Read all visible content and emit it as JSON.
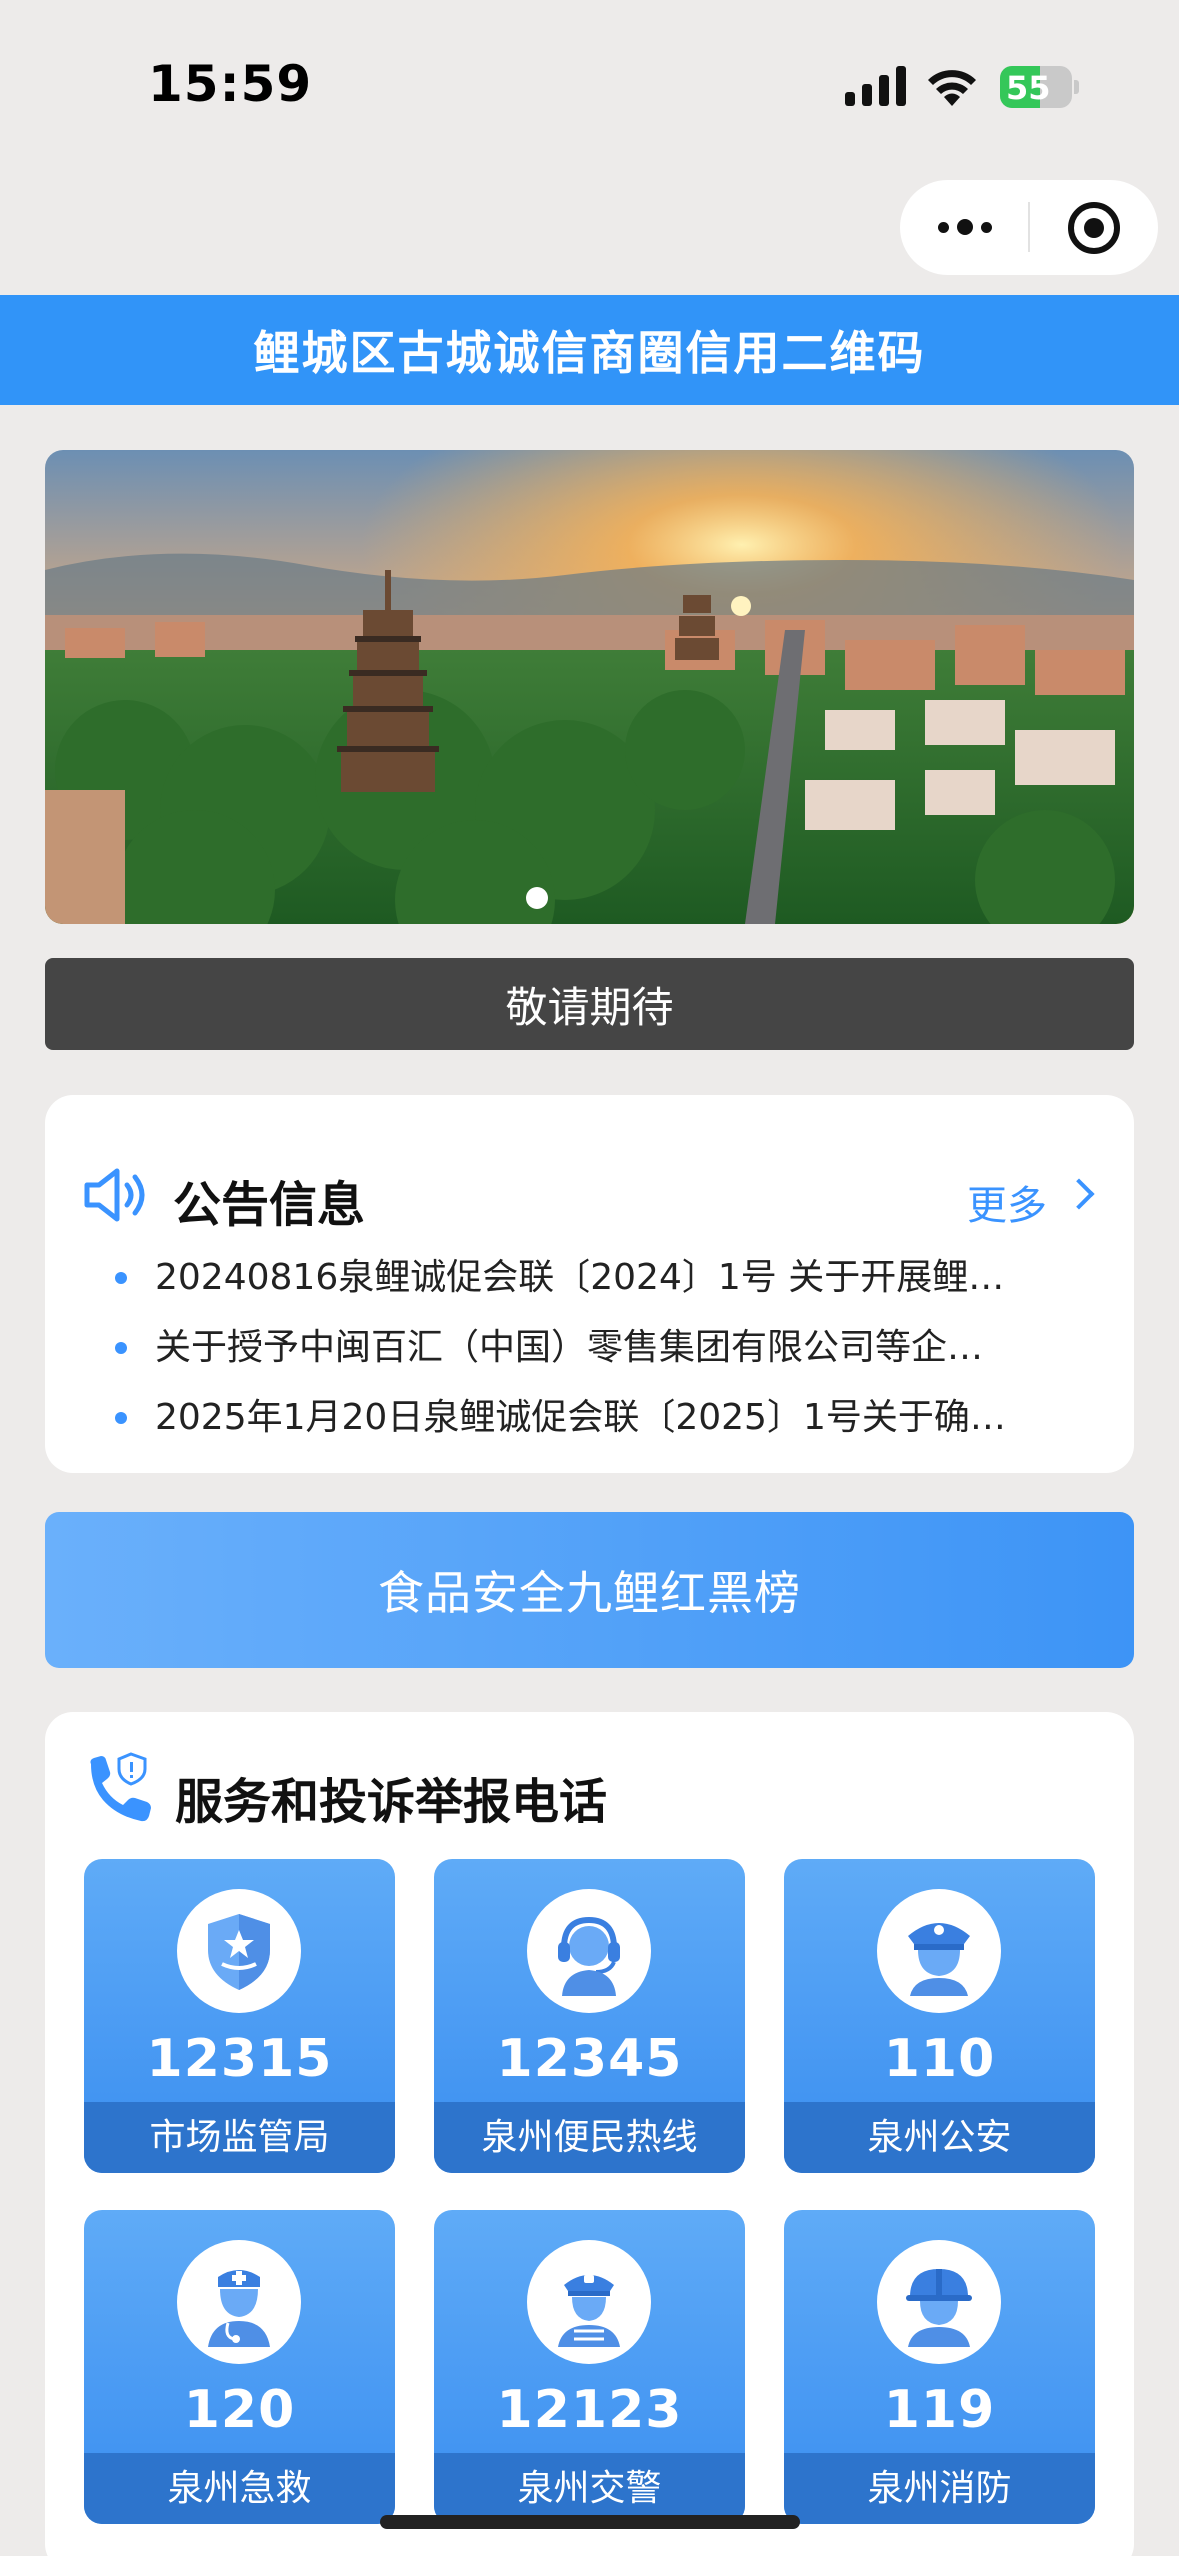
{
  "status_bar": {
    "time": "15:59",
    "battery": "55",
    "battery_level": 0.55
  },
  "header": {
    "title": "鲤城区古城诚信商圈信用二维码"
  },
  "banner": {
    "caption": "敬请期待"
  },
  "notice": {
    "title": "公告信息",
    "more": "更多",
    "items": [
      "20240816泉鲤诚促会联〔2024〕1号 关于开展鲤…",
      "关于授予中闽百汇（中国）零售集团有限公司等企…",
      "2025年1月20日泉鲤诚促会联〔2025〕1号关于确…"
    ]
  },
  "red_black_list": {
    "label": "食品安全九鲤红黑榜"
  },
  "hotline": {
    "title": "服务和投诉举报电话",
    "tiles": [
      {
        "number": "12315",
        "label": "市场监管局",
        "icon": "shield-badge-icon"
      },
      {
        "number": "12345",
        "label": "泉州便民热线",
        "icon": "headset-agent-icon"
      },
      {
        "number": "110",
        "label": "泉州公安",
        "icon": "police-officer-icon"
      },
      {
        "number": "120",
        "label": "泉州急救",
        "icon": "doctor-icon"
      },
      {
        "number": "12123",
        "label": "泉州交警",
        "icon": "traffic-police-icon"
      },
      {
        "number": "119",
        "label": "泉州消防",
        "icon": "firefighter-icon"
      }
    ]
  },
  "colors": {
    "primary": "#3194f8",
    "accent": "#3a93ff",
    "tile_label": "#2d74cc",
    "background": "#edebea"
  }
}
